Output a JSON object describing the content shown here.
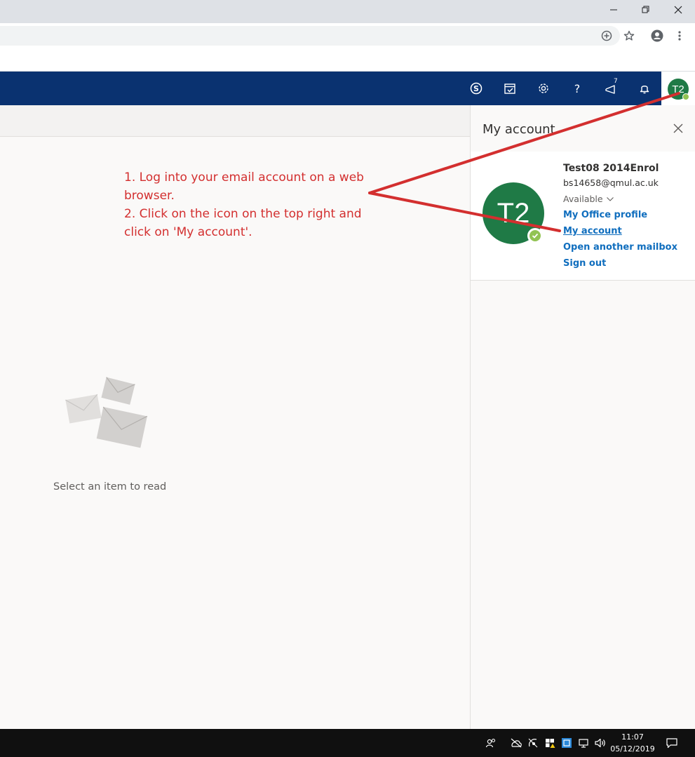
{
  "outlook_header": {
    "feedback_badge": "7",
    "me_initials": "T2"
  },
  "annotation": {
    "line1": "1. Log into your email account on a web browser.",
    "line2": "2. Click on the icon on the top right and click on 'My account'."
  },
  "reading_pane": {
    "empty_text": "Select an item to read"
  },
  "account_panel": {
    "title": "My account",
    "initials": "T2",
    "display_name": "Test08 2014Enrol",
    "email": "bs14658@qmul.ac.uk",
    "status": "Available",
    "links": {
      "office_profile": "My Office profile",
      "my_account": "My account",
      "open_mailbox": "Open another mailbox",
      "sign_out": "Sign out"
    }
  },
  "taskbar": {
    "time": "11:07",
    "date": "05/12/2019"
  },
  "colors": {
    "suite_bar": "#0a3270",
    "avatar": "#1f7a46",
    "presence": "#92c353",
    "link": "#106ebe",
    "annotation": "#d32f2f"
  }
}
